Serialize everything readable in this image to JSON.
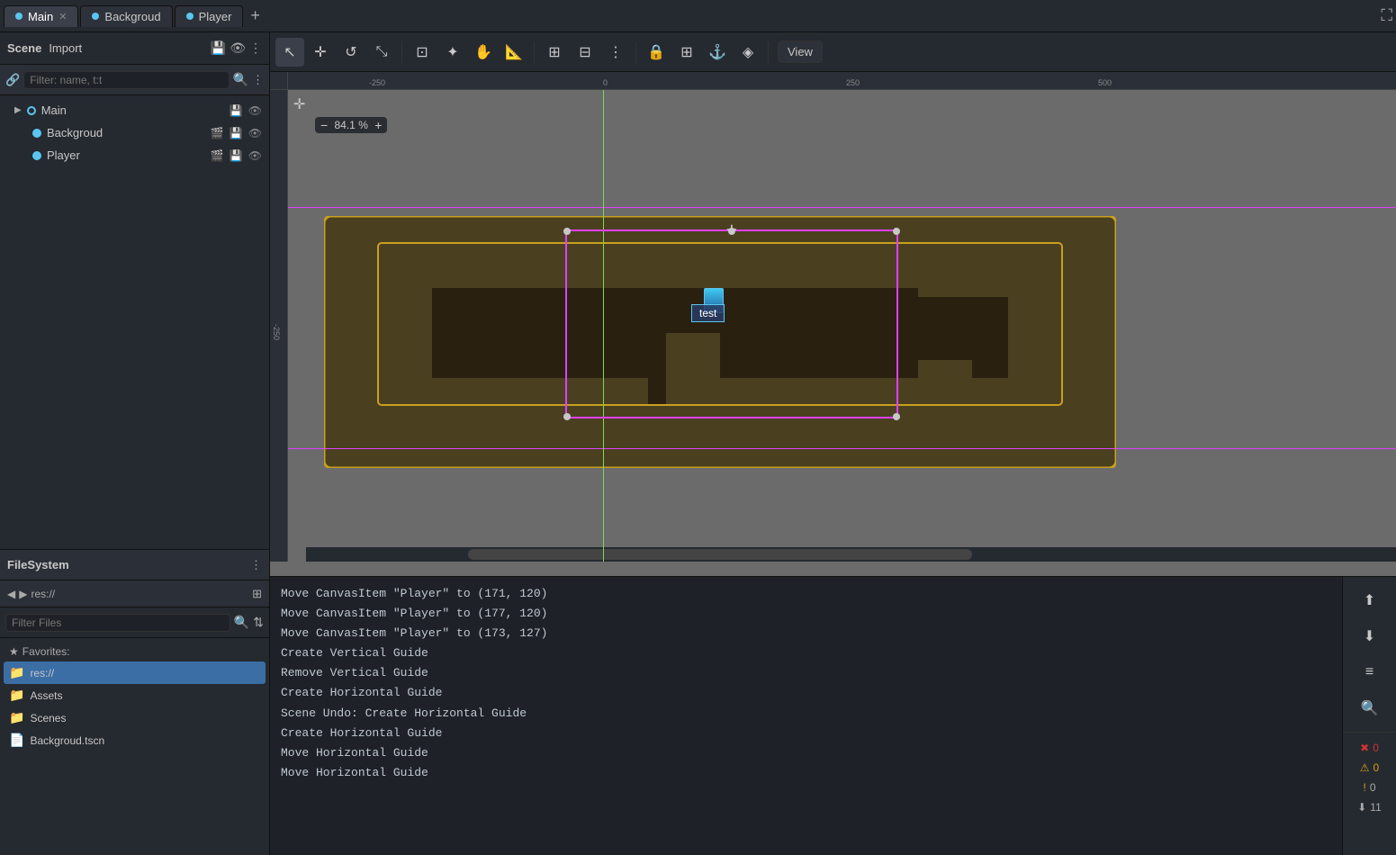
{
  "tabs": [
    {
      "id": "main",
      "label": "Main",
      "active": true,
      "closeable": true
    },
    {
      "id": "backgroud",
      "label": "Backgroud",
      "active": false,
      "closeable": false
    },
    {
      "id": "player",
      "label": "Player",
      "active": false,
      "closeable": false
    }
  ],
  "scene": {
    "title": "Scene",
    "import_label": "Import",
    "filter_placeholder": "Filter: name, t:t",
    "items": [
      {
        "label": "Main",
        "level": 0,
        "dot_filled": false
      },
      {
        "label": "Backgroud",
        "level": 1,
        "dot_filled": true
      },
      {
        "label": "Player",
        "level": 1,
        "dot_filled": true
      }
    ]
  },
  "filesystem": {
    "title": "FileSystem",
    "filter_placeholder": "Filter Files",
    "path": "res://",
    "favorites_label": "Favorites:",
    "items": [
      {
        "label": "res://",
        "type": "folder",
        "selected": true
      },
      {
        "label": "Assets",
        "type": "folder",
        "selected": false
      },
      {
        "label": "Scenes",
        "type": "folder",
        "selected": false
      },
      {
        "label": "Backgroud.tscn",
        "type": "file",
        "selected": false
      }
    ]
  },
  "toolbar": {
    "view_label": "View",
    "zoom_label": "84.1 %"
  },
  "viewport": {
    "zoom": "84.1 %",
    "player_label": "test"
  },
  "log": {
    "entries": [
      "Move CanvasItem \"Player\" to (171, 120)",
      "Move CanvasItem \"Player\" to (177, 120)",
      "Move CanvasItem \"Player\" to (173, 127)",
      "Create Vertical Guide",
      "Remove Vertical Guide",
      "Create Horizontal Guide",
      "Scene Undo: Create Horizontal Guide",
      "Create Horizontal Guide",
      "Move Horizontal Guide",
      "Move Horizontal Guide"
    ]
  },
  "sidebar_counts": {
    "error": "0",
    "warning": "0",
    "info": "0",
    "debug": "11"
  }
}
